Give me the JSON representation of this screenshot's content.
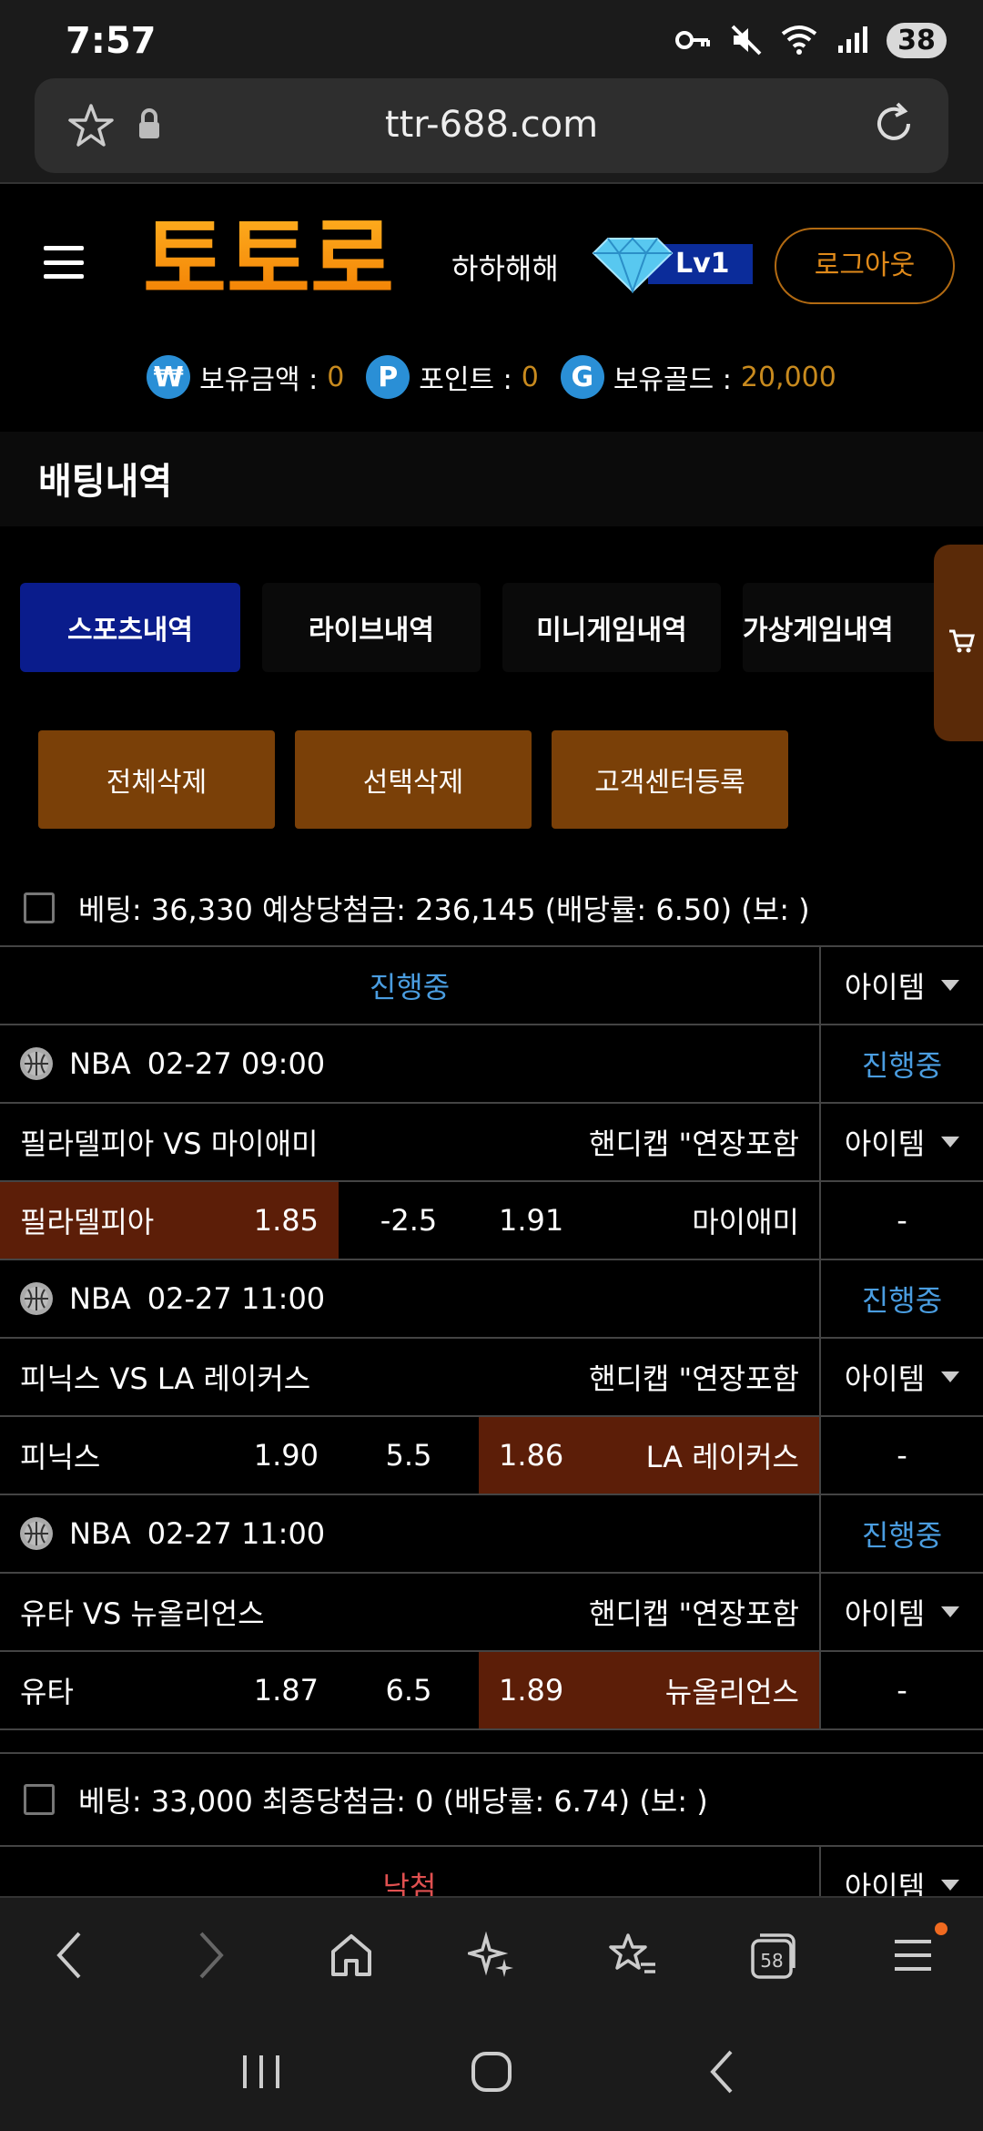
{
  "status_bar": {
    "time": "7:57",
    "battery": "38"
  },
  "browser": {
    "url": "ttr-688.com",
    "tab_count": "58"
  },
  "header": {
    "logo_text": "토토로",
    "username": "하하해해",
    "level": "Lv1",
    "logout_label": "로그아웃"
  },
  "balances": {
    "won_icon": "₩",
    "money_label": "보유금액 :",
    "money_value": "0",
    "point_icon": "P",
    "point_label": "포인트 :",
    "point_value": "0",
    "gold_icon": "G",
    "gold_label": "보유골드 :",
    "gold_value": "20,000"
  },
  "page_title": "배팅내역",
  "tabs": [
    "스포츠내역",
    "라이브내역",
    "미니게임내역",
    "가상게임내역"
  ],
  "actions": [
    "전체삭제",
    "선택삭제",
    "고객센터등록"
  ],
  "bets": [
    {
      "summary": "베팅: 36,330 예상당첨금: 236,145 (배당률: 6.50) (보: )",
      "status": "진행중",
      "item_label": "아이템",
      "games": [
        {
          "league": "NBA",
          "datetime": "02-27 09:00",
          "status": "진행중",
          "match": "필라델피아 VS 마이애미",
          "market": "핸디캡 \"연장포함",
          "item_label": "아이템",
          "home": "필라델피아",
          "home_odds": "1.85",
          "line": "-2.5",
          "away_odds": "1.91",
          "away": "마이애미",
          "result": "-"
        },
        {
          "league": "NBA",
          "datetime": "02-27 11:00",
          "status": "진행중",
          "match": "피닉스 VS LA 레이커스",
          "market": "핸디캡 \"연장포함",
          "item_label": "아이템",
          "home": "피닉스",
          "home_odds": "1.90",
          "line": "5.5",
          "away_odds": "1.86",
          "away": "LA 레이커스",
          "result": "-"
        },
        {
          "league": "NBA",
          "datetime": "02-27 11:00",
          "status": "진행중",
          "match": "유타 VS 뉴올리언스",
          "market": "핸디캡 \"연장포함",
          "item_label": "아이템",
          "home": "유타",
          "home_odds": "1.87",
          "line": "6.5",
          "away_odds": "1.89",
          "away": "뉴올리언스",
          "result": "-"
        }
      ]
    },
    {
      "summary": "베팅: 33,000 최종당첨금: 0 (배당률: 6.74) (보: )",
      "status": "낙첨",
      "item_label": "아이템"
    }
  ],
  "colors": {
    "accent_orange": "#e08a1a",
    "selected_bg": "#5c1e08",
    "tab_active": "#0a1c8c",
    "status_blue": "#4a9de0"
  }
}
